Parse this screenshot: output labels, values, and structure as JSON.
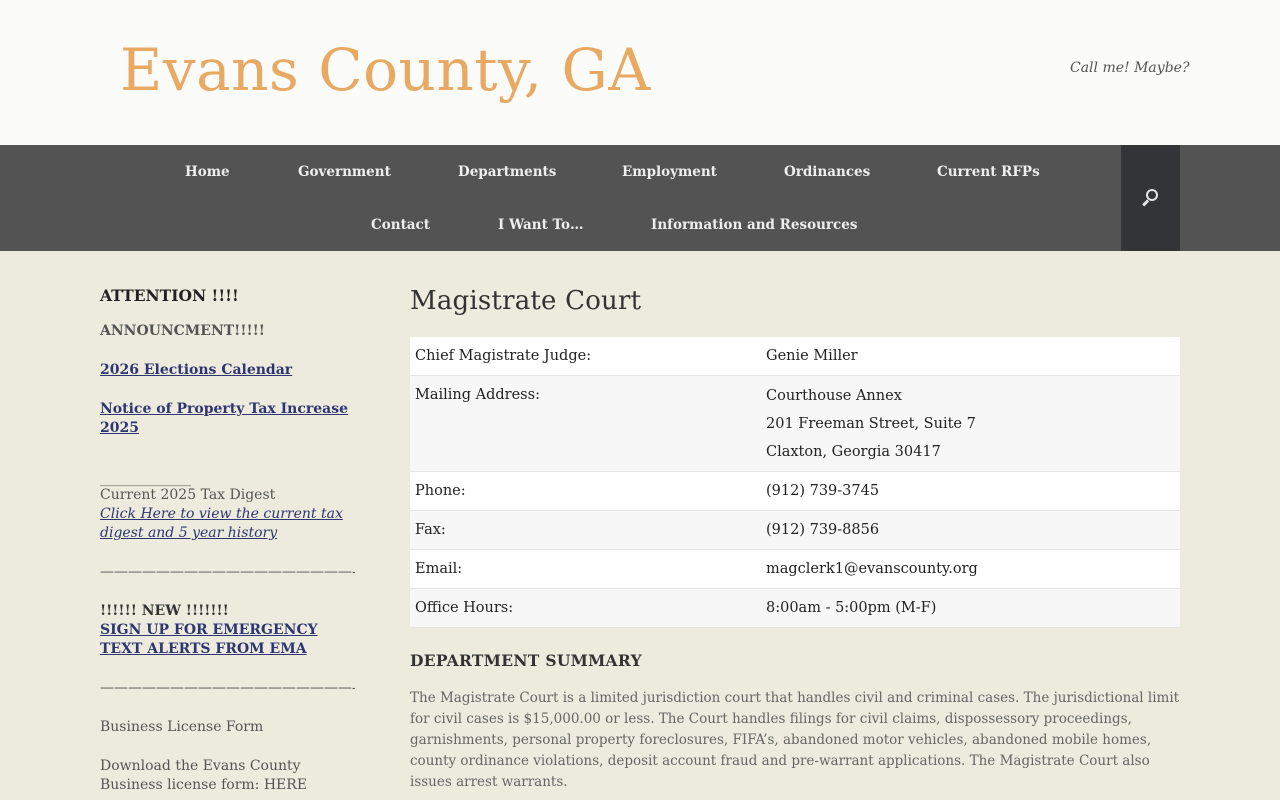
{
  "header": {
    "site_title": "Evans County, GA",
    "tagline": "Call me! Maybe?"
  },
  "nav": {
    "row1": [
      "Home",
      "Government",
      "Departments",
      "Employment",
      "Ordinances",
      "Current RFPs"
    ],
    "row2": [
      "Contact",
      "I Want To…",
      "Information and Resources"
    ],
    "search_icon": "search-icon"
  },
  "sidebar": {
    "heading": "ATTENTION !!!!",
    "announcement": "ANNOUNCMENT!!!!!",
    "elections_link": "2026 Elections Calendar",
    "tax_increase_link": "Notice of Property Tax Increase 2025",
    "short_rule": "_____________",
    "tax_digest_label": "Current 2025 Tax Digest",
    "tax_digest_link": "Click Here to view the current tax digest and 5 year history",
    "divider1": "——————————————————-",
    "new_label": "!!!!!! NEW !!!!!!!",
    "alerts_link": "SIGN UP FOR EMERGENCY TEXT ALERTS FROM EMA",
    "divider2": "——————————————————-",
    "business_license_label": "Business License Form",
    "business_license_text": "Download the Evans County Business license form: HERE"
  },
  "main": {
    "title": "Magistrate Court",
    "rows": [
      {
        "label": "Chief Magistrate Judge:",
        "value": "Genie Miller"
      },
      {
        "label": "Mailing Address:",
        "lines": [
          "Courthouse Annex",
          "201 Freeman Street, Suite 7",
          "Claxton, Georgia 30417"
        ]
      },
      {
        "label": "Phone:",
        "value": "(912) 739-3745"
      },
      {
        "label": "Fax:",
        "value": "(912) 739-8856"
      },
      {
        "label": "Email:",
        "value": "magclerk1@evanscounty.org"
      },
      {
        "label": "Office Hours:",
        "value": "8:00am - 5:00pm (M-F)"
      }
    ],
    "summary_heading": "DEPARTMENT SUMMARY",
    "summary_text": "The Magistrate Court is a limited jurisdiction court that handles civil and criminal cases. The jurisdictional limit for civil cases is $15,000.00 or less. The Court handles filings for civil claims, dispossessory proceedings, garnishments, personal property foreclosures, FIFA’s, abandoned motor vehicles, abandoned mobile homes, county ordinance violations, deposit account fraud and pre-warrant applications. The Magistrate Court also issues arrest warrants."
  },
  "colors": {
    "title": "#e8a962",
    "nav_bg": "#535353",
    "search_bg": "#333438",
    "page_bg": "#ecebdd",
    "link": "#2e3572"
  }
}
